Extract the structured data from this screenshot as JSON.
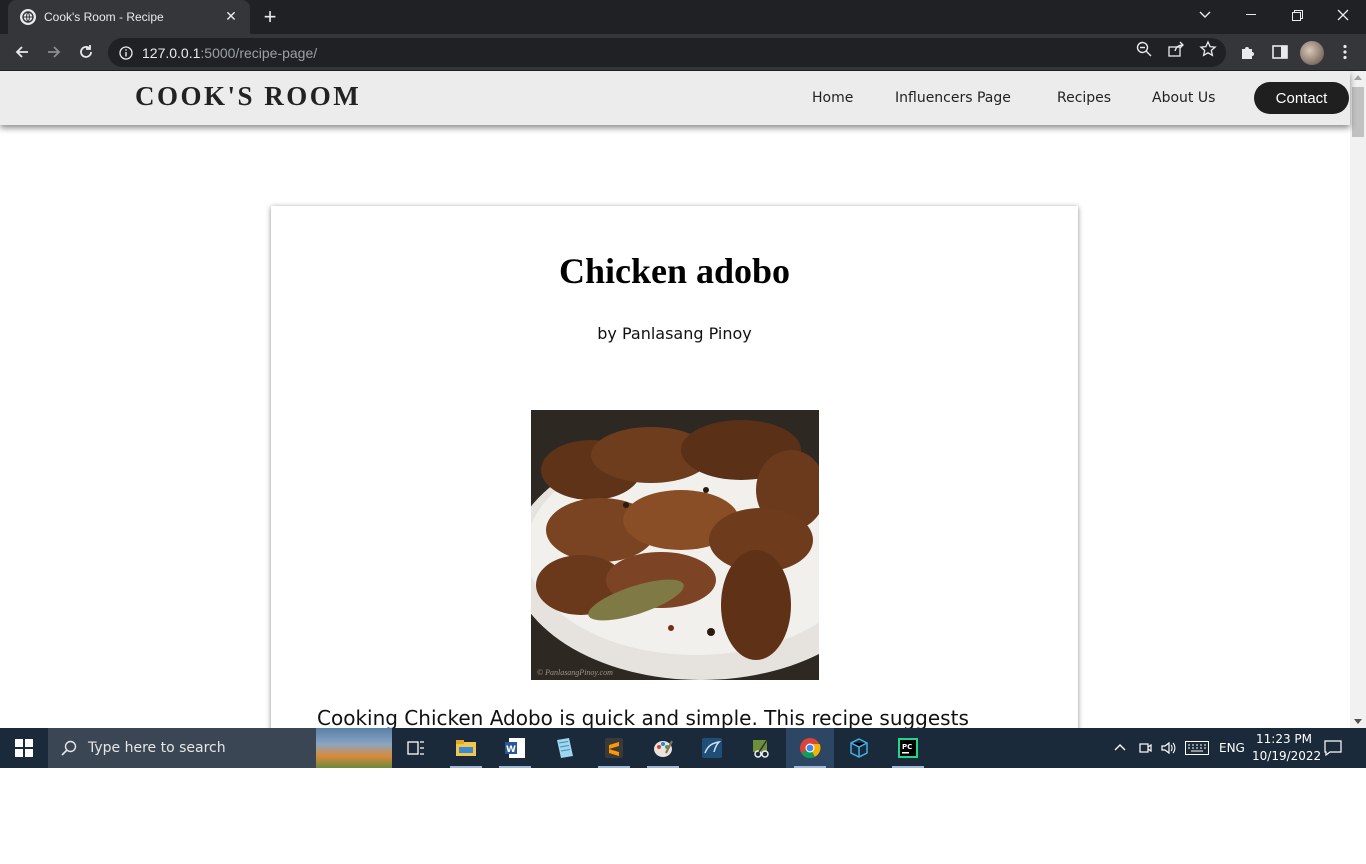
{
  "browser": {
    "tab_title": "Cook's Room - Recipe",
    "new_tab": "+",
    "url_host": "127.0.0.1",
    "url_rest": ":5000/recipe-page/"
  },
  "site": {
    "brand": "COOK'S ROOM",
    "nav": [
      "Home",
      "Influencers Page",
      "Recipes",
      "About Us"
    ],
    "contact_label": "Contact"
  },
  "recipe": {
    "title": "Chicken adobo",
    "author": "by Panlasang Pinoy",
    "photo_watermark": "© PanlasangPinoy.com",
    "description": "Cooking Chicken Adobo is quick and simple. This recipe suggests"
  },
  "taskbar": {
    "search_placeholder": "Type here to search",
    "language": "ENG",
    "time": "11:23 PM",
    "date": "10/19/2022"
  },
  "colors": {
    "chrome_dark": "#202124",
    "chrome_tab": "#35363a",
    "nav_bg": "#ececec",
    "contact_bg": "#1f1f1f",
    "taskbar_bg": "#1b2a3a"
  }
}
